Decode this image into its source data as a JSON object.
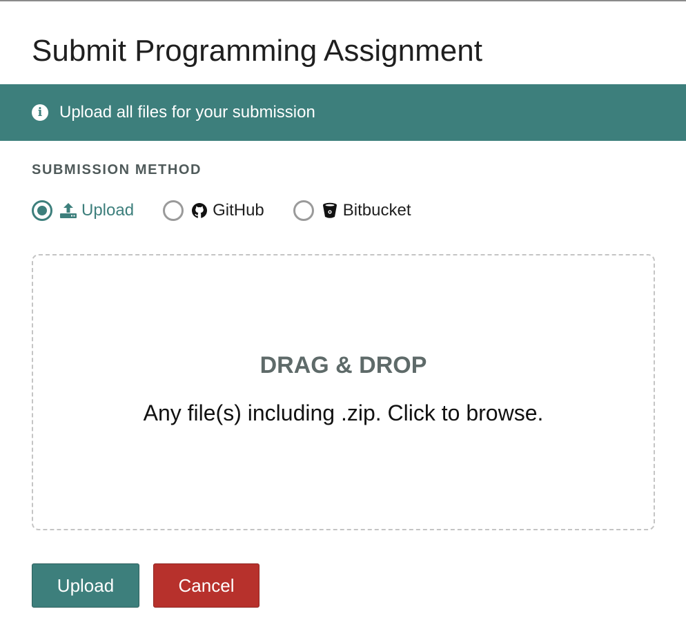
{
  "dialog": {
    "title": "Submit Programming Assignment"
  },
  "banner": {
    "icon": "info-icon",
    "text": "Upload all files for your submission",
    "background": "#3d7f7c"
  },
  "submission": {
    "section_label": "SUBMISSION METHOD",
    "methods": [
      {
        "label": "Upload",
        "icon": "upload-icon",
        "selected": true
      },
      {
        "label": "GitHub",
        "icon": "github-icon",
        "selected": false
      },
      {
        "label": "Bitbucket",
        "icon": "bitbucket-icon",
        "selected": false
      }
    ]
  },
  "dropzone": {
    "title": "DRAG & DROP",
    "hint": "Any file(s) including .zip. Click to browse."
  },
  "actions": {
    "upload_label": "Upload",
    "cancel_label": "Cancel"
  },
  "colors": {
    "accent": "#3d7f7c",
    "danger": "#b7312c",
    "muted_heading": "#5e6a69"
  }
}
